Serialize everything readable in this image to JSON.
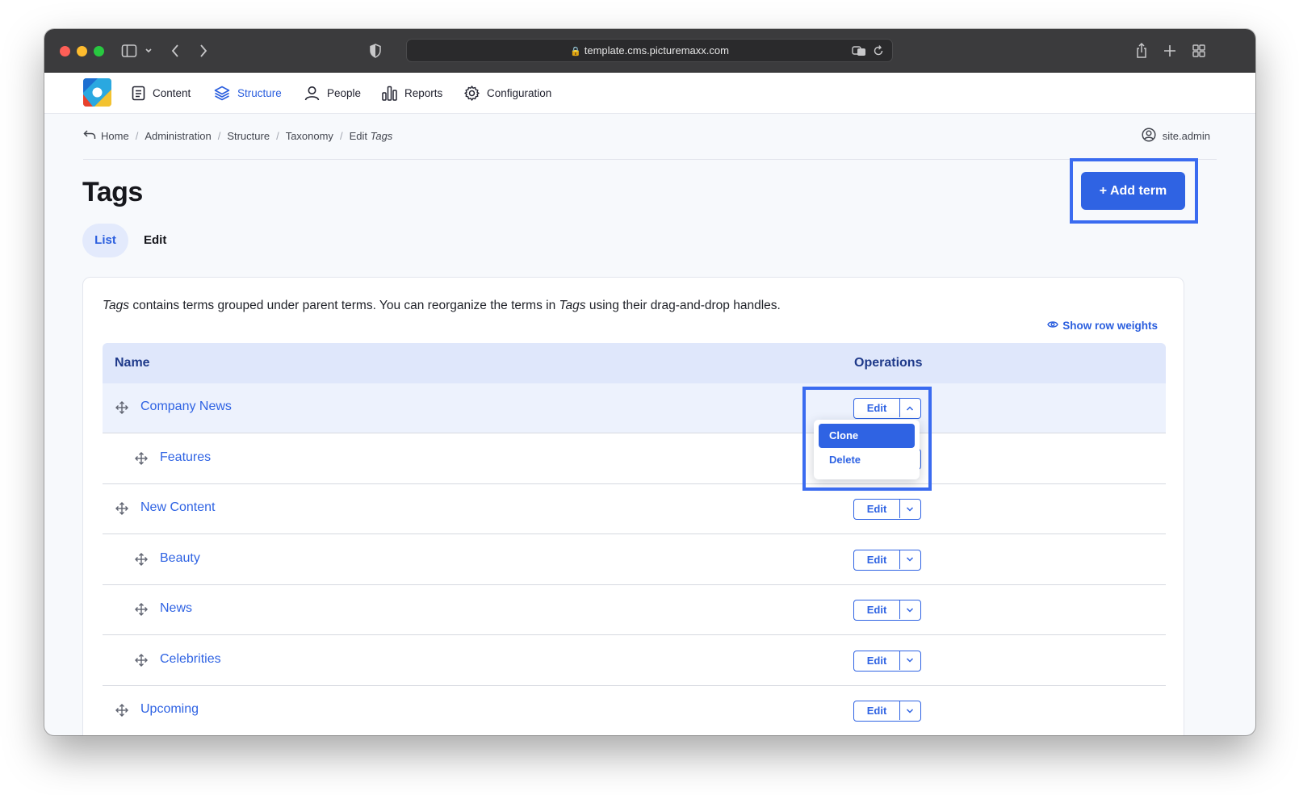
{
  "browser": {
    "url": "template.cms.picturemaxx.com"
  },
  "toolbar": {
    "items": [
      {
        "label": "Content"
      },
      {
        "label": "Structure"
      },
      {
        "label": "People"
      },
      {
        "label": "Reports"
      },
      {
        "label": "Configuration"
      }
    ],
    "active_item": "Structure"
  },
  "breadcrumb": {
    "items": [
      "Home",
      "Administration",
      "Structure",
      "Taxonomy"
    ],
    "current_prefix": "Edit",
    "current_em": "Tags"
  },
  "user": {
    "name": "site.admin"
  },
  "page": {
    "title": "Tags",
    "add_button": "+ Add term",
    "tabs": [
      {
        "label": "List",
        "active": true
      },
      {
        "label": "Edit",
        "active": false
      }
    ]
  },
  "description": {
    "em1": "Tags",
    "text1": " contains terms grouped under parent terms. You can reorganize the terms in ",
    "em2": "Tags",
    "text2": " using their drag-and-drop handles."
  },
  "show_weights": "Show row weights",
  "table": {
    "headers": {
      "name": "Name",
      "operations": "Operations"
    },
    "rows": [
      {
        "name": "Company News",
        "depth": 0,
        "op": "Edit"
      },
      {
        "name": "Features",
        "depth": 1,
        "op": "Edit"
      },
      {
        "name": "New Content",
        "depth": 0,
        "op": "Edit"
      },
      {
        "name": "Beauty",
        "depth": 1,
        "op": "Edit"
      },
      {
        "name": "News",
        "depth": 1,
        "op": "Edit"
      },
      {
        "name": "Celebrities",
        "depth": 1,
        "op": "Edit"
      },
      {
        "name": "Upcoming",
        "depth": 0,
        "op": "Edit"
      }
    ]
  },
  "dropdown": {
    "items": [
      "Clone",
      "Delete"
    ],
    "highlighted": "Clone"
  },
  "colors": {
    "accent": "#2f63e3",
    "highlight_frame": "#3a6bf0"
  }
}
